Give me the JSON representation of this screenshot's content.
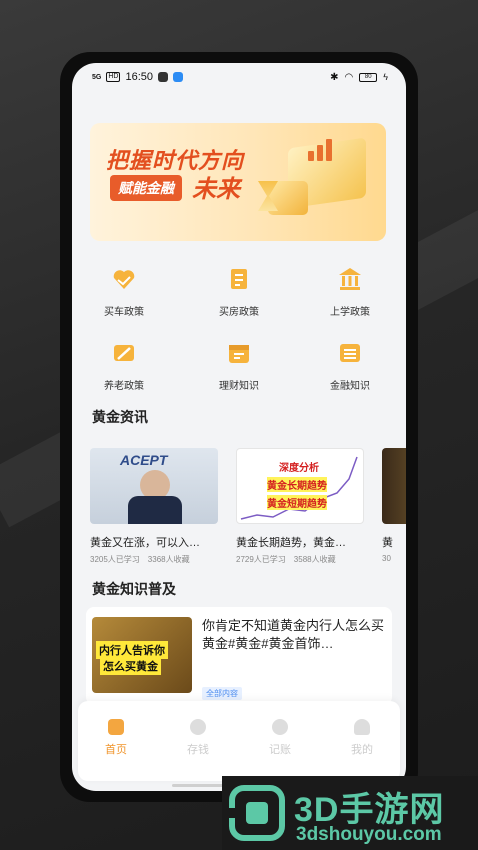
{
  "status_bar": {
    "signal": "5G",
    "hd": "HD",
    "time": "16:50",
    "battery": "80"
  },
  "banner": {
    "line1": "把握时代方向",
    "tag": "赋能金融",
    "line2": "未来"
  },
  "categories": [
    {
      "label": "买车政策",
      "icon": "heart-hand-icon"
    },
    {
      "label": "买房政策",
      "icon": "document-icon"
    },
    {
      "label": "上学政策",
      "icon": "bank-icon"
    },
    {
      "label": "养老政策",
      "icon": "flag-icon"
    },
    {
      "label": "理财知识",
      "icon": "calendar-icon"
    },
    {
      "label": "金融知识",
      "icon": "list-icon"
    }
  ],
  "news_section": {
    "title": "黄金资讯"
  },
  "news": [
    {
      "title": "黄金又在涨，可以入…",
      "learners": "3205人已学习",
      "saves": "3368人收藏",
      "thumb_text": "ACEPT"
    },
    {
      "title": "黄金长期趋势，黄金…",
      "learners": "2729人已学习",
      "saves": "3588人收藏",
      "thumb_lines": [
        "深度分析",
        "黄金长期趋势",
        "黄金短期趋势"
      ]
    },
    {
      "title": "黄",
      "learners": "30",
      "saves": ""
    }
  ],
  "knowledge_section": {
    "title": "黄金知识普及"
  },
  "knowledge": {
    "title": "你肯定不知道黄金内行人怎么买黄金#黄金#黄金首饰…",
    "thumb_line1": "内行人告诉你",
    "thumb_line2": "怎么买黄金",
    "tag": "全部内容"
  },
  "tabbar": [
    {
      "label": "首页",
      "active": true
    },
    {
      "label": "存钱",
      "active": false
    },
    {
      "label": "记账",
      "active": false
    },
    {
      "label": "我的",
      "active": false
    }
  ],
  "watermark": {
    "big": "3D手游网",
    "small": "3dshouyou.com"
  },
  "colors": {
    "accent": "#f0962e",
    "banner_red": "#e34f1f",
    "watermark": "#5cc8a6"
  }
}
